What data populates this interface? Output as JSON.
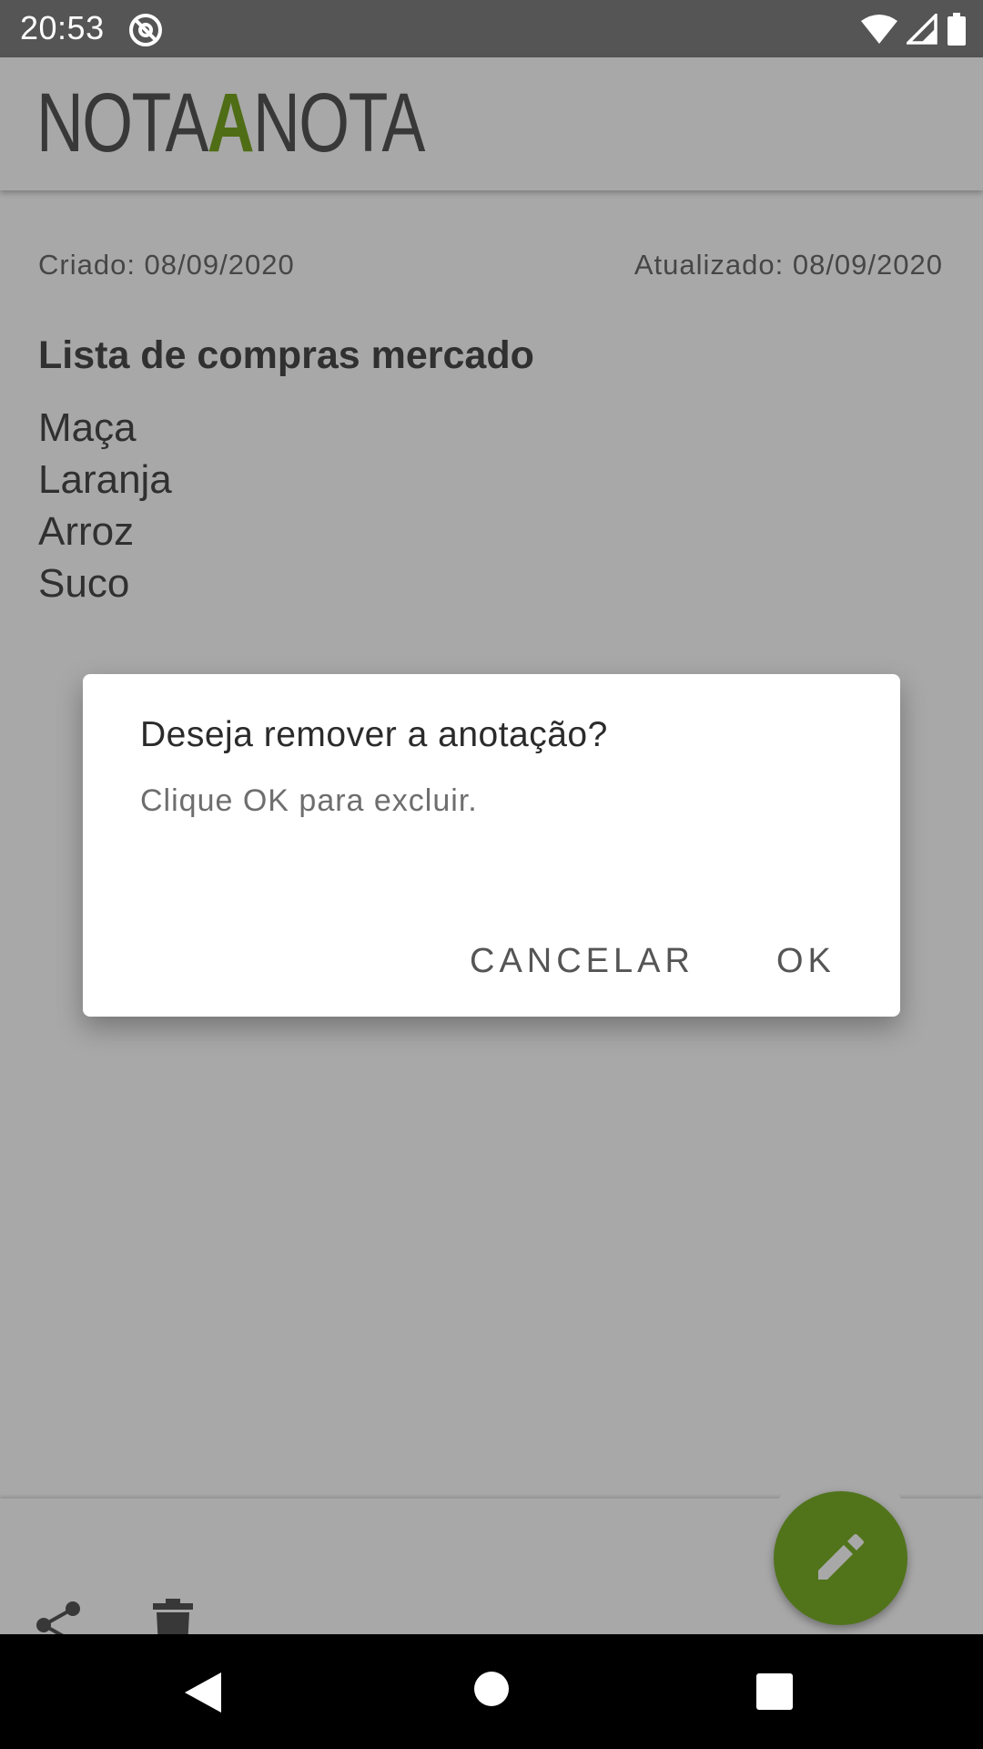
{
  "status_bar": {
    "time": "20:53",
    "icons": [
      "at-sign-icon",
      "wifi-icon",
      "signal-icon",
      "battery-icon"
    ]
  },
  "app": {
    "logo": {
      "part1": "NOTA",
      "accent": "A",
      "part2": "NOTA"
    },
    "accent_color": "#79a620"
  },
  "note": {
    "created": "Criado: 08/09/2020",
    "updated": "Atualizado: 08/09/2020",
    "title": "Lista de compras mercado",
    "lines": [
      "Maça",
      "Laranja",
      "Arroz",
      "Suco"
    ]
  },
  "bottom_bar": {
    "icons": [
      "share-icon",
      "delete-icon"
    ],
    "fab_icon": "edit-pencil-icon",
    "fab_color": "#7cb02a"
  },
  "dialog": {
    "title": "Deseja remover a anotação?",
    "message": "Clique OK para excluir.",
    "cancel_label": "CANCELAR",
    "ok_label": "OK"
  },
  "nav_bar": {
    "icons": [
      "back-icon",
      "home-icon",
      "recents-icon"
    ]
  }
}
